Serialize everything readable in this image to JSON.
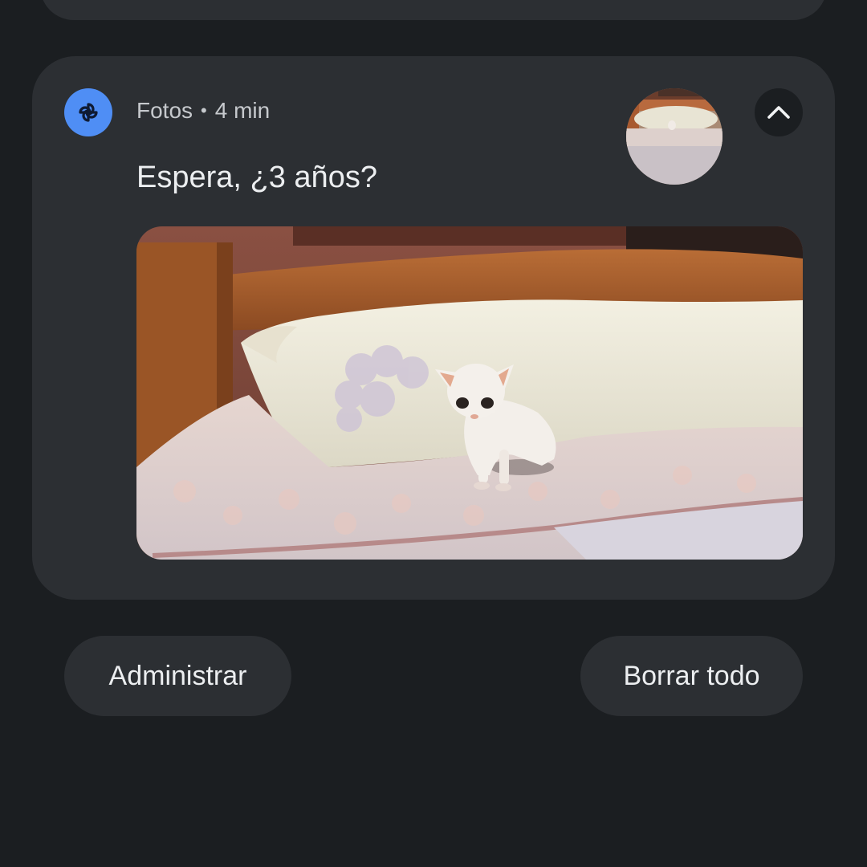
{
  "notification": {
    "app_name": "Fotos",
    "separator": "•",
    "time": "4 min",
    "title": "Espera, ¿3 años?",
    "app_icon": "pinwheel-icon",
    "expand_icon": "chevron-up-icon",
    "accent_color": "#4f8ef5"
  },
  "actions": {
    "manage_label": "Administrar",
    "clear_all_label": "Borrar todo"
  }
}
